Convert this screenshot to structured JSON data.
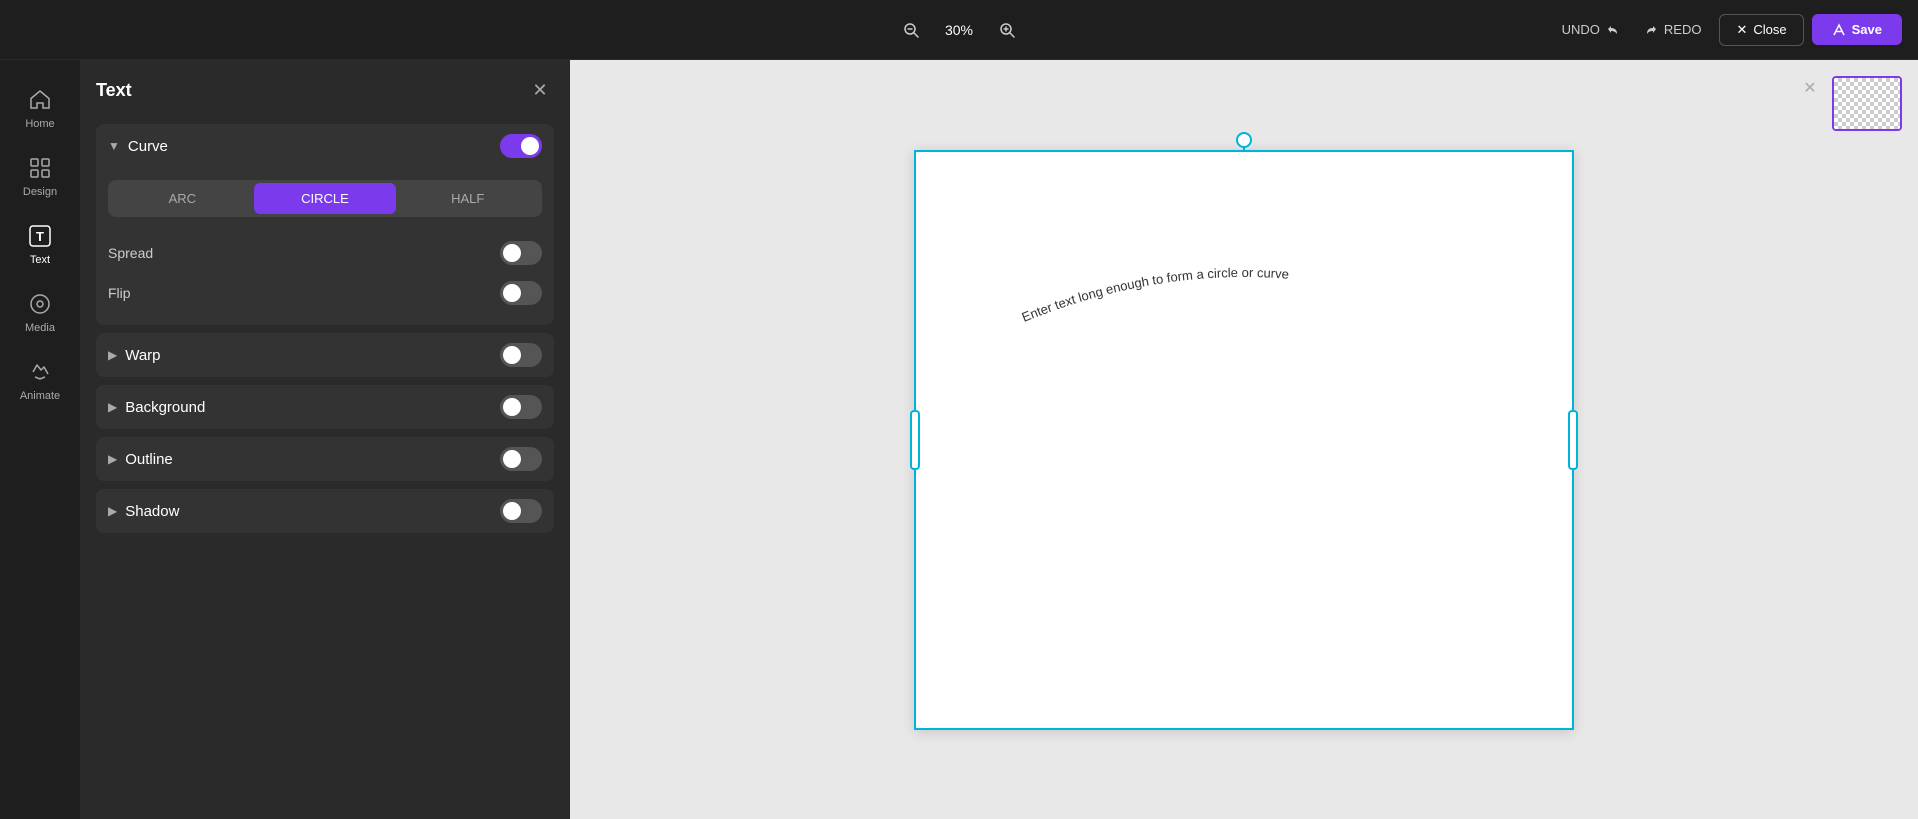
{
  "topbar": {
    "zoom": "30%",
    "zoom_in_label": "+",
    "zoom_out_label": "−",
    "undo_label": "UNDO",
    "redo_label": "REDO",
    "close_label": "Close",
    "save_label": "Save"
  },
  "sidebar": {
    "items": [
      {
        "id": "home",
        "label": "Home",
        "icon": "⌂"
      },
      {
        "id": "design",
        "label": "Design",
        "icon": "▤"
      },
      {
        "id": "text",
        "label": "Text",
        "icon": "T",
        "active": true
      },
      {
        "id": "media",
        "label": "Media",
        "icon": "◎"
      },
      {
        "id": "animate",
        "label": "Animate",
        "icon": "⚡"
      }
    ]
  },
  "panel": {
    "title": "Text",
    "curve": {
      "label": "Curve",
      "toggle_on": true,
      "tabs": [
        "ARC",
        "CIRCLE",
        "HALF"
      ],
      "active_tab": "CIRCLE",
      "spread_label": "Spread",
      "spread_on": false,
      "flip_label": "Flip",
      "flip_on": false
    },
    "warp": {
      "label": "Warp",
      "toggle_on": false
    },
    "background": {
      "label": "Background",
      "toggle_on": false
    },
    "outline": {
      "label": "Outline",
      "toggle_on": false
    },
    "shadow": {
      "label": "Shadow",
      "toggle_on": false
    }
  },
  "canvas": {
    "curved_text": "Enter text long enough to form a circle or curve"
  }
}
